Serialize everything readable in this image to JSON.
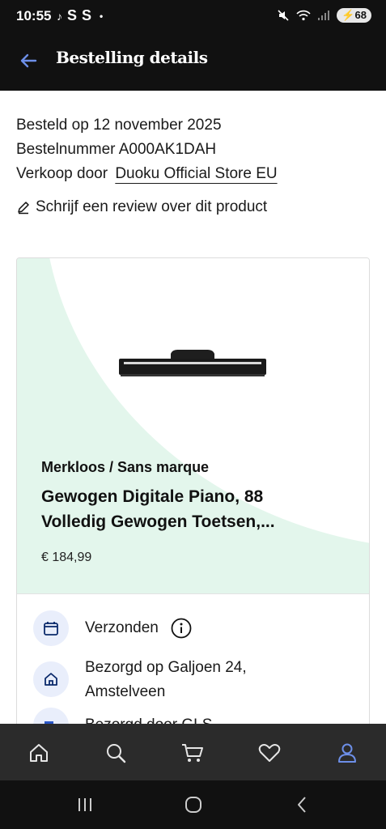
{
  "status_bar": {
    "time": "10:55",
    "left_letters": [
      "S",
      "S"
    ],
    "dot": "•",
    "battery": "68"
  },
  "header": {
    "title": "Bestelling details"
  },
  "order": {
    "date_line": "Besteld op 12 november 2025",
    "number_line": "Bestelnummer A000AK1DAH",
    "seller_prefix": "Verkoop door",
    "seller_name": "Duoku Official Store EU",
    "review_link": "Schrijf een review over dit product"
  },
  "product": {
    "brand": "Merkloos / Sans marque",
    "name": "Gewogen Digitale Piano, 88 Volledig Gewogen Toetsen,...",
    "price": "€ 184,99"
  },
  "shipment": {
    "status": "Verzonden",
    "delivery_line1": "Bezorgd op Galjoen 24,",
    "delivery_line2": "Amstelveen",
    "partial_line": "Bezorgd door GLS"
  },
  "colors": {
    "accent_blue": "#6d8fe8",
    "mint": "#e3f6ec",
    "dark": "#111111",
    "nav_bg": "#2b2b2b"
  },
  "bottom_nav": {
    "items": [
      "home-icon",
      "search-icon",
      "cart-icon",
      "heart-icon",
      "user-icon"
    ],
    "active": "user-icon"
  }
}
